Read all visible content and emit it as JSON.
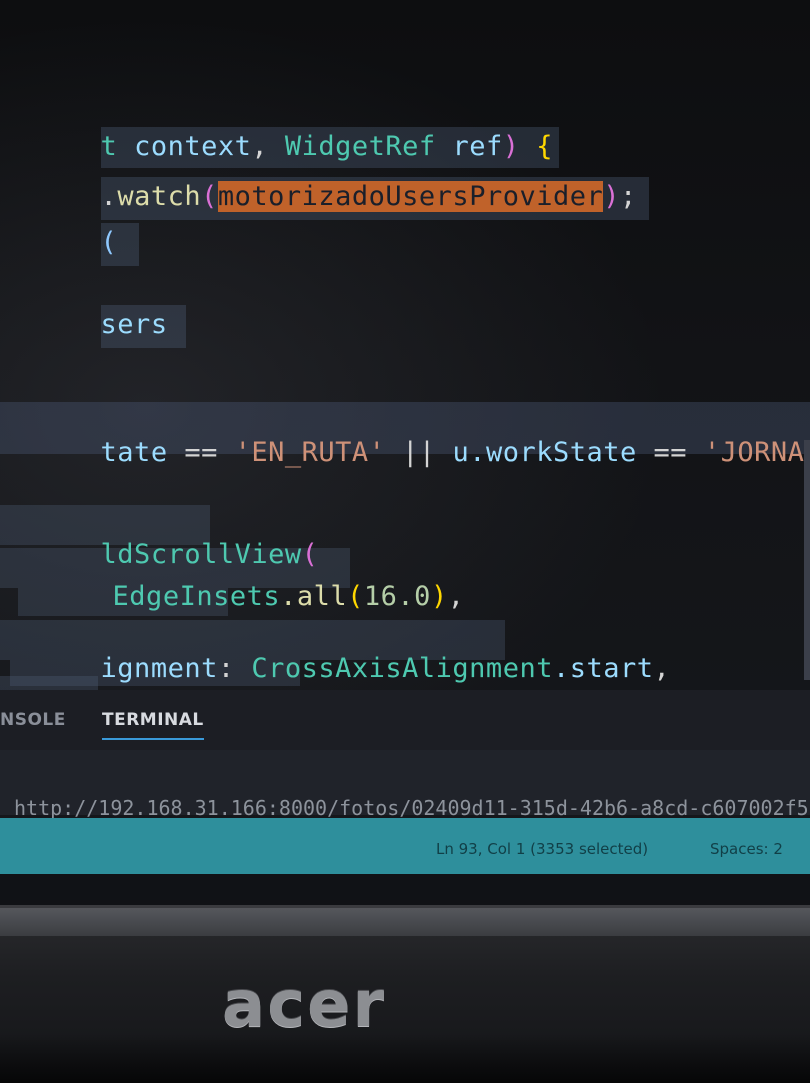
{
  "editor": {
    "lines": {
      "l1_a": "t ",
      "l1_b": "context",
      "l1_c": ", ",
      "l1_d": "WidgetRef",
      "l1_e": " ref",
      "l1_f": ") ",
      "l1_g": "{",
      "l2_a": ".",
      "l2_b": "watch",
      "l2_c": "(",
      "l2_d": "motorizadoUsersProvider",
      "l2_e": ")",
      "l2_f": ";",
      "l3_a": "(",
      "l4_a": "sers",
      "l5_a": "tate",
      "l5_b": " == ",
      "l5_c": "'EN_RUTA'",
      "l5_d": " || ",
      "l5_e": "u",
      "l5_f": ".workState",
      "l5_g": " == ",
      "l5_h": "'JORNADA_ACTIVA'",
      "l6_a": "ldScrollView",
      "l6_b": "(",
      "l7_a": "EdgeInsets",
      "l7_b": ".all",
      "l7_c": "(",
      "l7_d": "16.0",
      "l7_e": ")",
      "l7_f": ",",
      "l8_a": "ignment",
      "l8_b": ": ",
      "l8_c": "CrossAxisAlignment",
      "l8_d": ".start",
      "l8_e": ","
    }
  },
  "panel": {
    "tabs": [
      {
        "label": "NSOLE"
      },
      {
        "label": "TERMINAL"
      }
    ],
    "terminal_text": "http://192.168.31.166:8000/fotos/02409d11-315d-42b6-a8cd-c607002f5"
  },
  "status_bar": {
    "cursor": "Ln 93, Col 1 (3353 selected)",
    "spaces": "Spaces: 2"
  },
  "monitor": {
    "brand": "acer"
  },
  "colors": {
    "accent": "#2e8f9c",
    "selection": "#c0622a"
  }
}
